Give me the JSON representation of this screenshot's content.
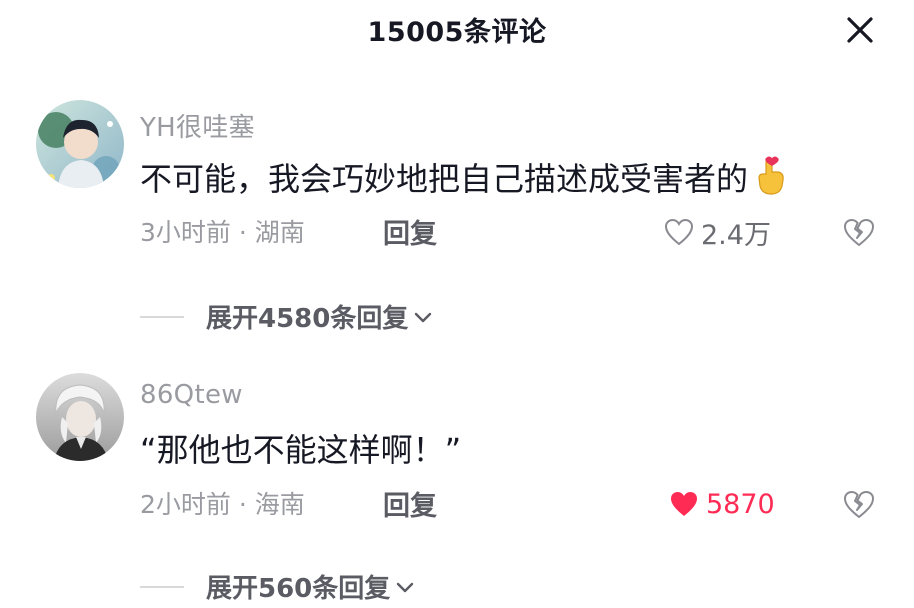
{
  "header": {
    "title": "15005条评论",
    "close_icon": "close-icon"
  },
  "comments": [
    {
      "username": "YH很哇塞",
      "content": "不可能，我会巧妙地把自己描述成受害者的",
      "emoji": "finger-heart-emoji",
      "time_location": "3小时前 · 湖南",
      "reply_label": "回复",
      "like_count": "2.4万",
      "liked": false,
      "expand_label": "展开4580条回复"
    },
    {
      "username": "86Qtew",
      "content": "“那他也不能这样啊！”",
      "time_location": "2小时前 · 海南",
      "reply_label": "回复",
      "like_count": "5870",
      "liked": true,
      "expand_label": "展开560条回复"
    }
  ],
  "colors": {
    "accent": "#fe2c55",
    "text_primary": "#161823",
    "text_secondary": "#9a9ba1"
  }
}
